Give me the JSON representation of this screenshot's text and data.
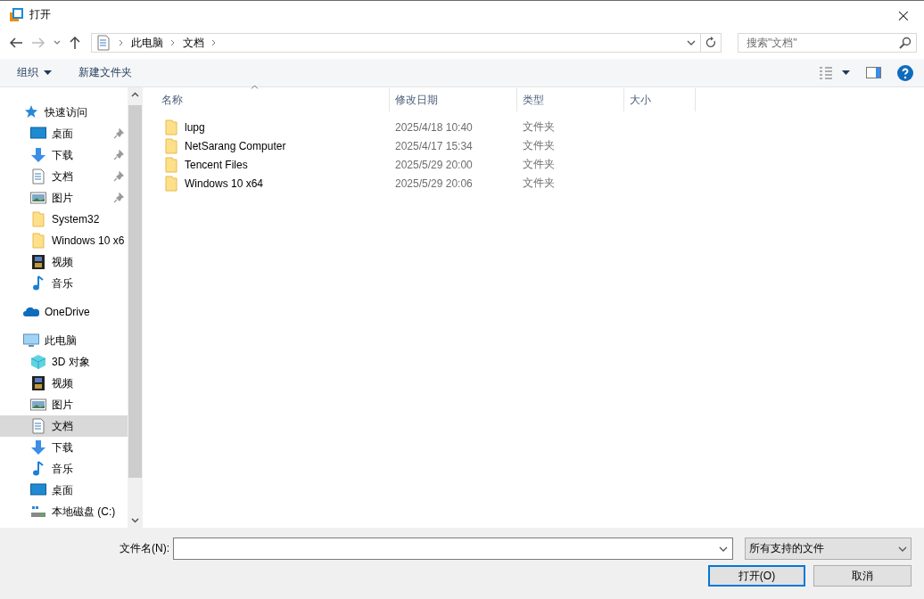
{
  "window": {
    "title": "打开",
    "close": "×"
  },
  "address": {
    "crumbs": [
      "此电脑",
      "文档"
    ]
  },
  "search": {
    "placeholder": "搜索\"文档\""
  },
  "toolbar": {
    "organize": "组织",
    "new_folder": "新建文件夹"
  },
  "sidebar": {
    "items": [
      {
        "label": "快速访问",
        "kind": "star",
        "selected": false,
        "children": [
          {
            "label": "桌面",
            "kind": "desktop",
            "pinned": true,
            "selected": false
          },
          {
            "label": "下载",
            "kind": "download",
            "pinned": true,
            "selected": false
          },
          {
            "label": "文档",
            "kind": "document",
            "pinned": true,
            "selected": false
          },
          {
            "label": "图片",
            "kind": "picture",
            "pinned": true,
            "selected": false
          },
          {
            "label": "System32",
            "kind": "folder",
            "pinned": false,
            "selected": false
          },
          {
            "label": "Windows 10 x6",
            "kind": "folder",
            "pinned": false,
            "selected": false
          },
          {
            "label": "视频",
            "kind": "video",
            "pinned": false,
            "selected": false
          },
          {
            "label": "音乐",
            "kind": "music",
            "pinned": false,
            "selected": false
          }
        ]
      },
      {
        "label": "OneDrive",
        "kind": "cloud",
        "selected": false
      },
      {
        "label": "此电脑",
        "kind": "computer",
        "selected": false,
        "children": [
          {
            "label": "3D 对象",
            "kind": "cube",
            "pinned": false,
            "selected": false
          },
          {
            "label": "视频",
            "kind": "video",
            "pinned": false,
            "selected": false
          },
          {
            "label": "图片",
            "kind": "picture",
            "pinned": false,
            "selected": false
          },
          {
            "label": "文档",
            "kind": "document",
            "pinned": false,
            "selected": true
          },
          {
            "label": "下载",
            "kind": "download",
            "pinned": false,
            "selected": false
          },
          {
            "label": "音乐",
            "kind": "music",
            "pinned": false,
            "selected": false
          },
          {
            "label": "桌面",
            "kind": "desktop",
            "pinned": false,
            "selected": false
          },
          {
            "label": "本地磁盘 (C:)",
            "kind": "drive",
            "pinned": false,
            "selected": false
          }
        ]
      }
    ]
  },
  "table": {
    "columns": [
      "名称",
      "修改日期",
      "类型",
      "大小"
    ],
    "rows": [
      {
        "name": "lupg",
        "modified": "2025/4/18 10:40",
        "type": "文件夹"
      },
      {
        "name": "NetSarang Computer",
        "modified": "2025/4/17 15:34",
        "type": "文件夹"
      },
      {
        "name": "Tencent Files",
        "modified": "2025/5/29 20:00",
        "type": "文件夹"
      },
      {
        "name": "Windows 10 x64",
        "modified": "2025/5/29 20:06",
        "type": "文件夹"
      }
    ]
  },
  "footer": {
    "filename_label": "文件名(N):",
    "filter": "所有支持的文件",
    "open_button": "打开(O)",
    "cancel_button": "取消"
  }
}
